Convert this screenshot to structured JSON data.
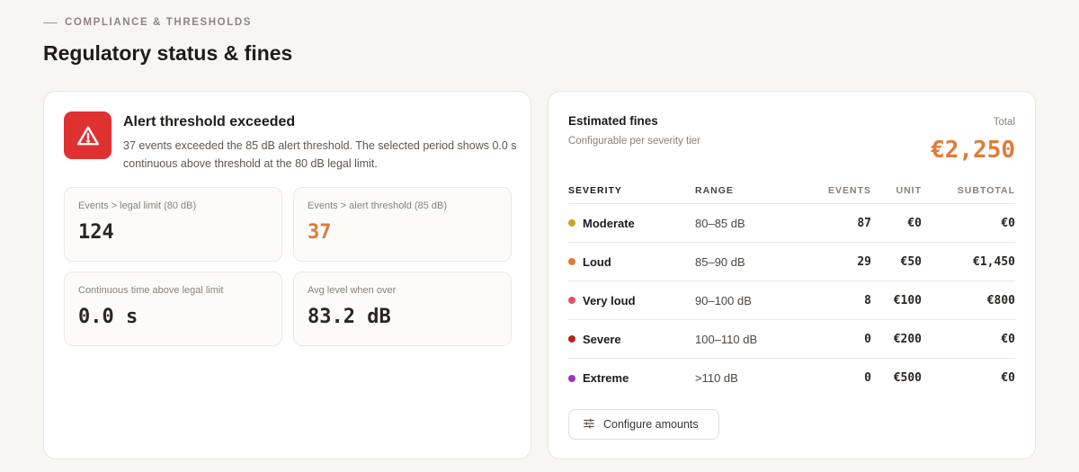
{
  "header": {
    "eyebrow": "COMPLIANCE & THRESHOLDS",
    "title": "Regulatory status & fines"
  },
  "alert": {
    "icon": "warning-triangle-icon",
    "title": "Alert threshold exceeded",
    "text": "37 events exceeded the 85 dB alert threshold. The selected period shows 0.0 s continuous above threshold at the 80 dB legal limit.",
    "color": "#e03131"
  },
  "stats": [
    {
      "label": "Events > legal limit (80 dB)",
      "value": "124"
    },
    {
      "label": "Events > alert threshold (85 dB)",
      "value": "37"
    },
    {
      "label": "Continuous time above legal limit",
      "value": "0.0 s"
    },
    {
      "label": "Avg level when over",
      "value": "83.2 dB"
    }
  ],
  "fines": {
    "title": "Estimated fines",
    "subtitle": "Configurable per severity tier",
    "total_label": "Total",
    "total_value": "€2,250",
    "accent": "#e07a3a",
    "columns": [
      "SEVERITY",
      "RANGE",
      "EVENTS",
      "UNIT",
      "SUBTOTAL"
    ],
    "rows": [
      {
        "severity": "Moderate",
        "color": "#c9a227",
        "range": "80–85 dB",
        "events": "87",
        "unit": "€0",
        "subtotal": "€0"
      },
      {
        "severity": "Loud",
        "color": "#e07a3a",
        "range": "85–90 dB",
        "events": "29",
        "unit": "€50",
        "subtotal": "€1,450"
      },
      {
        "severity": "Very loud",
        "color": "#e05263",
        "range": "90–100 dB",
        "events": "8",
        "unit": "€100",
        "subtotal": "€800"
      },
      {
        "severity": "Severe",
        "color": "#b3261e",
        "range": "100–110 dB",
        "events": "0",
        "unit": "€200",
        "subtotal": "€0"
      },
      {
        "severity": "Extreme",
        "color": "#9b30c9",
        "range": ">110 dB",
        "events": "0",
        "unit": "€500",
        "subtotal": "€0"
      }
    ],
    "configure_label": "Configure amounts",
    "configure_icon": "sliders-icon"
  }
}
